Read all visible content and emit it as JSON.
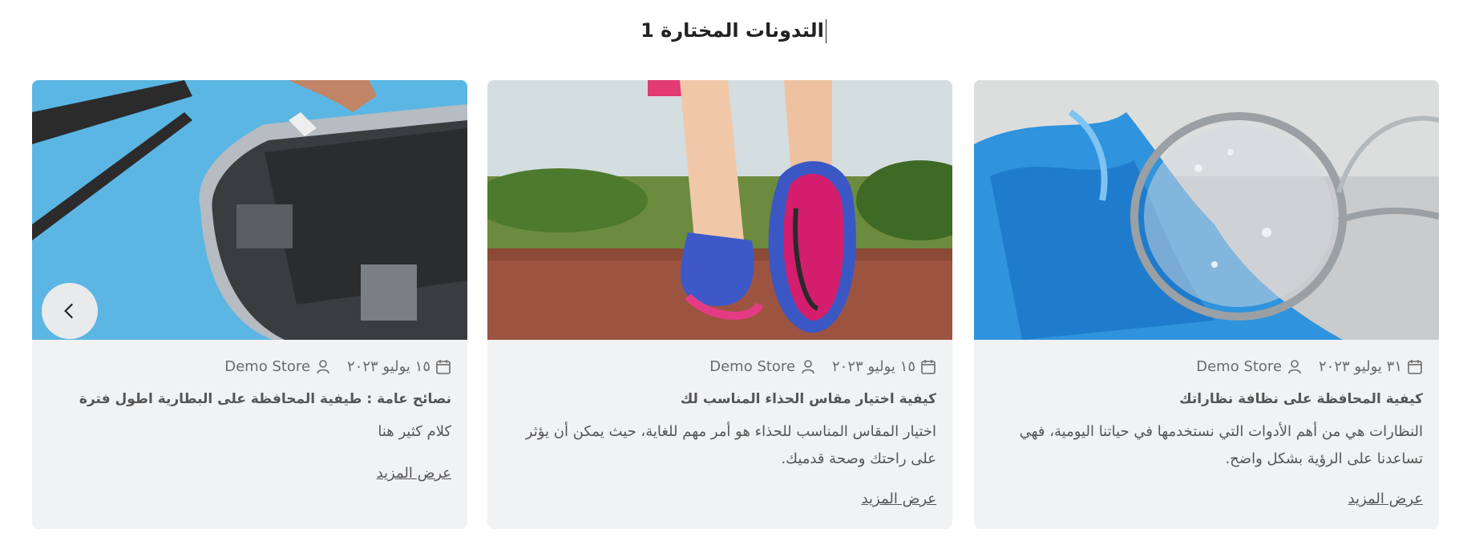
{
  "section": {
    "title": "التدونات المختارة 1"
  },
  "cards": [
    {
      "date": "٣١ يوليو ٢٠٢٣",
      "author": "Demo Store",
      "title": "كيفية المحافظة على نظافة نظاراتك",
      "excerpt": "النظارات هي من أهم الأدوات التي نستخدمها في حياتنا اليومية، فهي تساعدنا على الرؤية بشكل واضح.",
      "more": "عرض المزيد",
      "image_icon": "glasses-cleaning-photo"
    },
    {
      "date": "١٥ يوليو ٢٠٢٣",
      "author": "Demo Store",
      "title": "كيفية اختيار مقاس الحذاء المناسب لك",
      "excerpt": "اختيار المقاس المناسب للحذاء هو أمر مهم للغاية، حيث يمكن أن يؤثر على راحتك وصحة قدميك.",
      "more": "عرض المزيد",
      "image_icon": "running-shoes-photo"
    },
    {
      "date": "١٥ يوليو ٢٠٢٣",
      "author": "Demo Store",
      "title": "نصائح عامة : طيفية المحافظة على البطارية اطول فترة",
      "excerpt": "كلام كثير هنا",
      "more": "عرض المزيد",
      "image_icon": "phone-battery-repair-photo"
    }
  ],
  "nav": {
    "prev_icon": "chevron-left-icon"
  },
  "colors": {
    "card_bg": "#f1f2f4",
    "text": "#555555",
    "meta": "#6b6b6b",
    "blue": "#3b8fd9",
    "sky": "#5bb6e3"
  }
}
